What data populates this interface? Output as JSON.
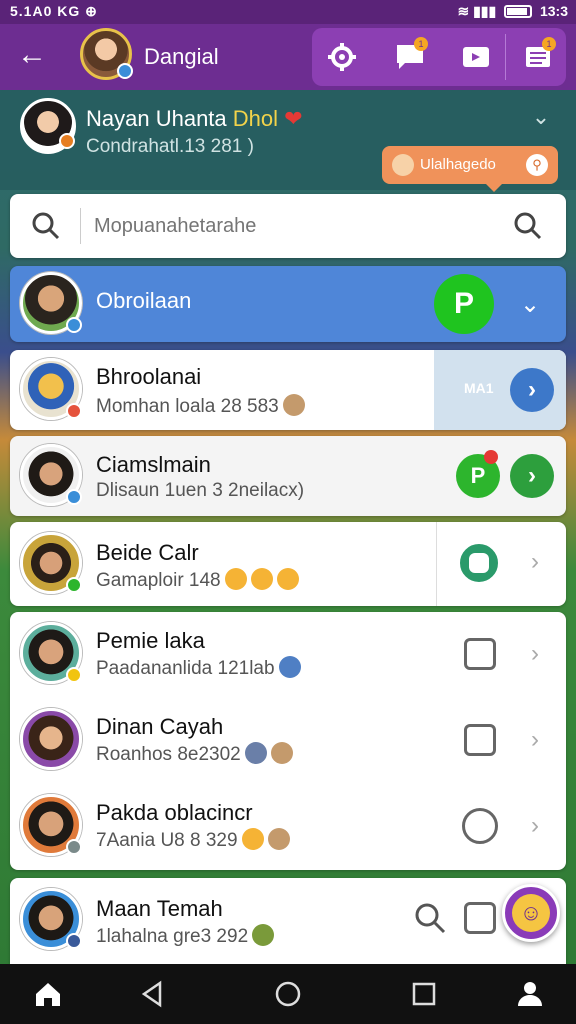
{
  "status_bar": {
    "left": "5.1A0 KG ⊕",
    "time": "13:3"
  },
  "app_bar": {
    "title": "Dangial",
    "badge_counts": {
      "notification": "1",
      "inbox": "1"
    }
  },
  "profile": {
    "name": "Nayan Uhanta",
    "name_highlight": "Dhol",
    "heart": "❤",
    "subtitle": "Condrahatl.13 281  )",
    "tooltip": "Ulalhagedo"
  },
  "search": {
    "placeholder": "Mopuanahetarahe"
  },
  "rows": [
    {
      "name": "Obroilaan",
      "subtitle": "",
      "active": true
    },
    {
      "name": "Bhroolanai",
      "subtitle": "Momhan loala 28 583",
      "chip": "MA1"
    },
    {
      "name": "Ciamslmain",
      "subtitle": "Dlisaun 1uen 3 2neilacx)"
    },
    {
      "name": "Beide Calr",
      "subtitle": "Gamaploir 148"
    },
    {
      "name": "Pemie laka",
      "subtitle": "Paadananlida 121lab"
    },
    {
      "name": "Dinan Cayah",
      "subtitle": "Roanhos 8e2302"
    },
    {
      "name": "Pakda oblacincr",
      "subtitle": "7Aania U8 8 329"
    },
    {
      "name": "Maan Temah",
      "subtitle": "1lahalna gre3 292"
    }
  ],
  "colors": {
    "accent": "#6d2d91",
    "active_row": "#4f86d8",
    "green": "#2db52d",
    "orange": "#f0925a"
  }
}
